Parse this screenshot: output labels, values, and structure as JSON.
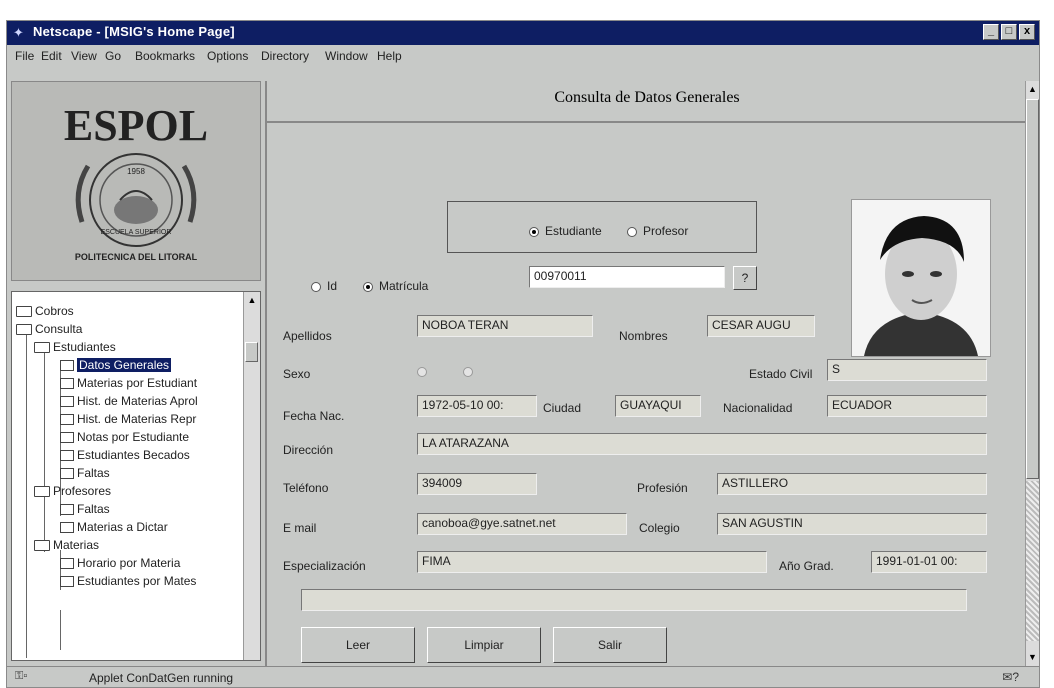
{
  "window": {
    "title": "Netscape - [MSIG's Home Page]",
    "minimize": "_",
    "maximize": "□",
    "close": "x"
  },
  "menu": [
    "File",
    "Edit",
    "View",
    "Go",
    "Bookmarks",
    "Options",
    "Directory",
    "Window",
    "Help"
  ],
  "logo": {
    "text": "ESPOL",
    "year": "1958",
    "motto": "ESCUELA SUPERIOR",
    "bottom": "POLITECNICA DEL LITORAL"
  },
  "tree": {
    "items": [
      {
        "label": "Cobros"
      },
      {
        "label": "Consulta"
      },
      {
        "label": "Estudiantes"
      },
      {
        "label": "Datos Generales"
      },
      {
        "label": "Materias por Estudiant"
      },
      {
        "label": "Hist. de Materias Aprol"
      },
      {
        "label": "Hist. de Materias Repr"
      },
      {
        "label": "Notas por Estudiante"
      },
      {
        "label": "Estudiantes Becados"
      },
      {
        "label": "Faltas"
      },
      {
        "label": "Profesores"
      },
      {
        "label": "Faltas"
      },
      {
        "label": "Materias a Dictar"
      },
      {
        "label": "Materias"
      },
      {
        "label": "Horario por Materia"
      },
      {
        "label": "Estudiantes por Mates"
      }
    ]
  },
  "form": {
    "heading": "Consulta de Datos Generales",
    "radio_estudiante": "Estudiante",
    "radio_profesor": "Profesor",
    "radio_id": "Id",
    "radio_matricula": "Matrícula",
    "matricula_value": "00970011",
    "lookup_button": "?",
    "apellidos_label": "Apellidos",
    "apellidos_value": "NOBOA TERAN",
    "nombres_label": "Nombres",
    "nombres_value": "CESAR AUGU",
    "sexo_label": "Sexo",
    "estado_civil_label": "Estado Civil",
    "estado_civil_value": "S",
    "fecha_nac_label": "Fecha Nac.",
    "fecha_nac_value": "1972-05-10 00:",
    "ciudad_label": "Ciudad",
    "ciudad_value": "GUAYAQUI",
    "nacionalidad_label": "Nacionalidad",
    "nacionalidad_value": "ECUADOR",
    "direccion_label": "Dirección",
    "direccion_value": "LA ATARAZANA",
    "telefono_label": "Teléfono",
    "telefono_value": "394009",
    "profesion_label": "Profesión",
    "profesion_value": "ASTILLERO",
    "email_label": "E mail",
    "email_value": "canoboa@gye.satnet.net",
    "colegio_label": "Colegio",
    "colegio_value": "SAN AGUSTIN",
    "especializacion_label": "Especialización",
    "especializacion_value": "FIMA",
    "ano_grad_label": "Año Grad.",
    "ano_grad_value": "1991-01-01 00:",
    "message_value": "",
    "leer_button": "Leer",
    "limpiar_button": "Limpiar",
    "salir_button": "Salir"
  },
  "status": {
    "text": "Applet ConDatGen running"
  },
  "colors": {
    "titlebar": "#0e1e63",
    "window": "#c7c9c7",
    "selection": "#0e1e63"
  }
}
